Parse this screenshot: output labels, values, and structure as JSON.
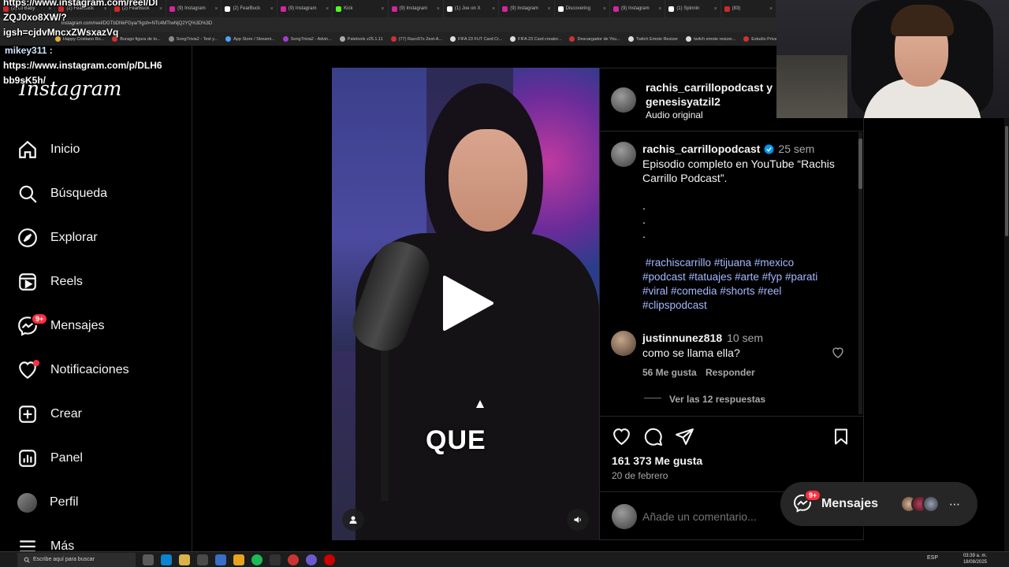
{
  "browser": {
    "tabs": [
      {
        "label": "(2) Lil Baby",
        "color": "#cc2a2a"
      },
      {
        "label": "(2) FearBuck",
        "color": "#cc2a2a"
      },
      {
        "label": "(2) FearBuck",
        "color": "#cc2a2a"
      },
      {
        "label": "(9) Instagram",
        "color": "#d6249f"
      },
      {
        "label": "(2) FearBuck",
        "color": "#ffffff"
      },
      {
        "label": "(9) Instagram",
        "color": "#d6249f"
      },
      {
        "label": "Kick",
        "color": "#53fc18"
      },
      {
        "label": "(9) Instagram",
        "color": "#d6249f"
      },
      {
        "label": "(1) Joe on X",
        "color": "#ffffff"
      },
      {
        "label": "(9) Instagram",
        "color": "#d6249f"
      },
      {
        "label": "Discovering",
        "color": "#ffffff"
      },
      {
        "label": "(9) Instagram",
        "color": "#d6249f"
      },
      {
        "label": "(1) Spinnin",
        "color": "#ffffff"
      },
      {
        "label": "(83)",
        "color": "#cc2a2a"
      }
    ],
    "url": "instagram.com/reel/DGTbDNkFGya/?igsh=NTc4MTIwNjQ2YQ%3D%3D",
    "bookmarks": [
      {
        "label": "Happy Cristiano Ro...",
        "color": "#e3b341"
      },
      {
        "label": "Burago figura de to...",
        "color": "#c33"
      },
      {
        "label": "SongTrivia2 - Test y...",
        "color": "#888"
      },
      {
        "label": "App Store / Streami...",
        "color": "#4aa3ff"
      },
      {
        "label": "SongTrivia2 - Advin...",
        "color": "#a33ccc"
      },
      {
        "label": "Paletools v25.1.11",
        "color": "#aaa"
      },
      {
        "label": "(77) Razo97s Zest-A...",
        "color": "#c33"
      },
      {
        "label": "FIFA 23 FUT Card Cr...",
        "color": "#ddd"
      },
      {
        "label": "FIFA 23 Card creator...",
        "color": "#ddd"
      },
      {
        "label": "Descargador de You...",
        "color": "#c33"
      },
      {
        "label": "Twitch Emote Resizer",
        "color": "#ddd"
      },
      {
        "label": "twitch emote resizer...",
        "color": "#ddd"
      },
      {
        "label": "Estudio Priva",
        "color": "#c33"
      }
    ]
  },
  "chat": {
    "line1": "https://www.instagram.com/reel/DI",
    "line2": "ZQJ0xo8XW/?",
    "line3": "igsh=cjdvMncxZWsxazVq",
    "user": "mikey311 :",
    "line4": "https://www.instagram.com/p/DLH6",
    "line5": "bb9sK5h/"
  },
  "sidebar": {
    "logo": "Instagram",
    "items": [
      {
        "label": "Inicio",
        "icon": "home-icon"
      },
      {
        "label": "Búsqueda",
        "icon": "search-icon"
      },
      {
        "label": "Explorar",
        "icon": "compass-icon"
      },
      {
        "label": "Reels",
        "icon": "reels-icon"
      },
      {
        "label": "Mensajes",
        "icon": "messenger-icon",
        "badge": "9+"
      },
      {
        "label": "Notificaciones",
        "icon": "heart-icon"
      },
      {
        "label": "Crear",
        "icon": "plus-square-icon"
      },
      {
        "label": "Panel",
        "icon": "chart-icon"
      },
      {
        "label": "Perfil",
        "icon": "avatar"
      },
      {
        "label": "Más",
        "icon": "menu-icon"
      }
    ]
  },
  "video": {
    "caption": "QUE"
  },
  "post": {
    "header_user": "rachis_carrillopodcast y",
    "header_user2": "genesisyatzil2",
    "audio": "Audio original",
    "author": "rachis_carrillopodcast",
    "author_time": "25 sem",
    "desc_line1": "Episodio completo en YouTube “Rachis",
    "desc_line2": "Carrillo Podcast”.",
    "dots": ".",
    "hashtags": [
      "#rachiscarrillo",
      "#tijuana",
      "#mexico",
      "#podcast",
      "#tatuajes",
      "#arte",
      "#fyp",
      "#parati",
      "#viral",
      "#comedia",
      "#shorts",
      "#reel",
      "#clipspodcast"
    ],
    "comment": {
      "user": "justinnunez818",
      "time": "10 sem",
      "text": "como se llama ella?",
      "likes": "56 Me gusta",
      "reply": "Responder",
      "view_replies": "Ver las 12 respuestas"
    },
    "likes": "161 373 Me gusta",
    "date": "20 de febrero",
    "comment_placeholder": "Añade un comentario..."
  },
  "messages_pill": {
    "label": "Mensajes",
    "badge": "9+"
  },
  "taskbar": {
    "search": "Escribe aquí para buscar",
    "lang": "ESP",
    "time": "03:39 a. m.",
    "date": "18/08/2025"
  },
  "colors": {
    "instagram_red": "#ff3040",
    "hashtag_blue": "#a5b8ff",
    "panel_border": "#262626"
  }
}
